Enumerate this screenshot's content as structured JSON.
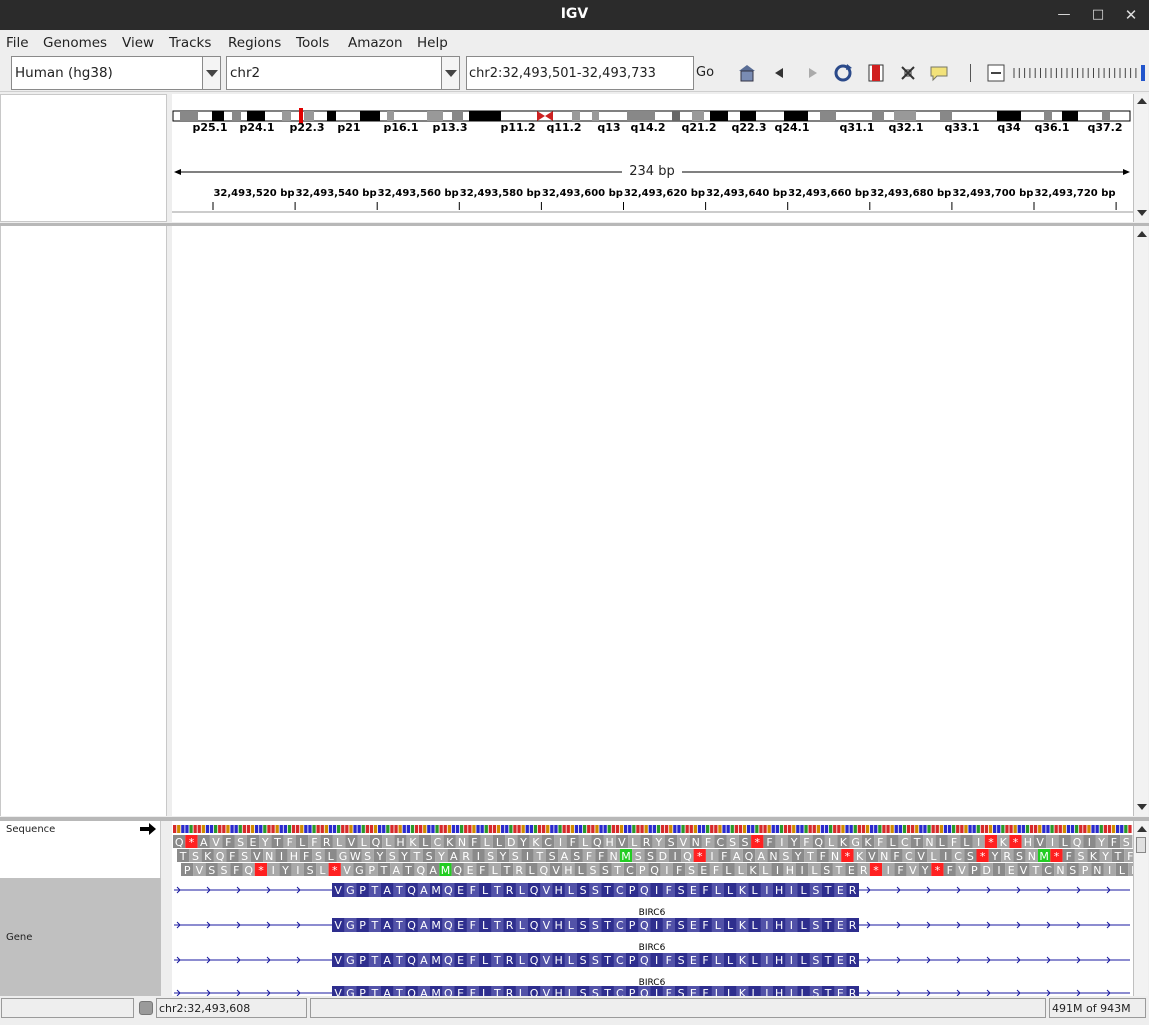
{
  "window": {
    "title": "IGV"
  },
  "menu": [
    "File",
    "Genomes",
    "View",
    "Tracks",
    "Regions",
    "Tools",
    "Amazon",
    "Help"
  ],
  "toolbar": {
    "genome": "Human (hg38)",
    "chromosome": "chr2",
    "locus": "chr2:32,493,501-32,493,733",
    "go_label": "Go"
  },
  "ideogram": {
    "bands": [
      "p25.1",
      "p24.1",
      "p22.3",
      "p21",
      "p16.1",
      "p13.3",
      "p11.2",
      "q11.2",
      "q13",
      "q14.2",
      "q21.2",
      "q22.3",
      "q24.1",
      "q31.1",
      "q32.1",
      "q33.1",
      "q34",
      "q36.1",
      "q37.2"
    ]
  },
  "ruler": {
    "span": "234 bp",
    "ticks": [
      "32,493,520 bp",
      "32,493,540 bp",
      "32,493,560 bp",
      "32,493,580 bp",
      "32,493,600 bp",
      "32,493,620 bp",
      "32,493,640 bp",
      "32,493,660 bp",
      "32,493,680 bp",
      "32,493,700 bp",
      "32,493,720 bp",
      "32,"
    ]
  },
  "tracks": {
    "sequence_label": "Sequence",
    "gene_label": "Gene"
  },
  "translation": {
    "frame1": "Q*AVFSEYTFLFRLVLQLHKLCKNFLLDYKCIFLQHVLRYSVNFCSS*FIYFQLKGKFLCTNLFLI*K*HVILQIYFS",
    "frame2": "TSKQFSVNIHFSLGWSYSYTSYARISYSITSASFFNMSSDIQ*IFAQANSYTFN*KVNFCVLICS*YRSNM*FSKYTF",
    "frame3": "PVSSFQ*IYISL*VGPTATQAMQEFLTRLQVHLSSTCPQIFSEFLLKLIHILSTER*IFVY*FVPDIEVTCNSPNILF"
  },
  "genes": {
    "name": "BIRC6",
    "exon_aa": "VGPTATQAMQEFLTRLQVHLSSTCPQIFSEFLLKLIHILSTER"
  },
  "status": {
    "position": "chr2:32,493,608",
    "memory": "491M of 943M"
  },
  "colors": {
    "stop_codon": "#ff2020",
    "start_codon": "#22cc22",
    "exon": "#2e2e8e",
    "gene_line": "#1a1aa0",
    "centromere": "#cc2020",
    "current_band": "#e00000"
  }
}
